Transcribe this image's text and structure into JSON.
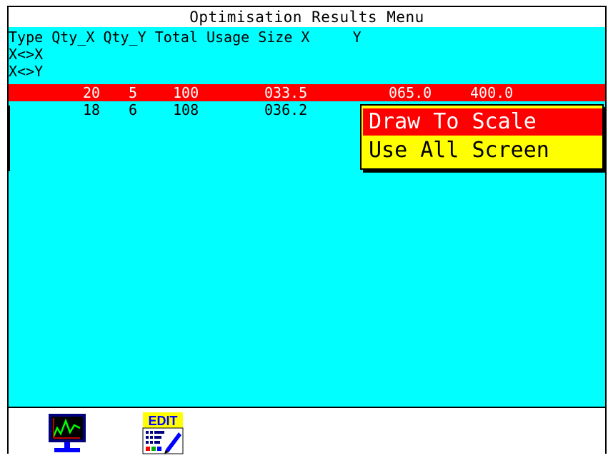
{
  "window": {
    "title": "Optimisation Results Menu"
  },
  "table": {
    "header": "Type Qty_X Qty_Y Total Usage Size X     Y",
    "type_options": [
      "X<>X",
      "X<>Y"
    ],
    "rows": [
      {
        "qty_x": "20",
        "qty_y": "5",
        "total": "100",
        "usage": "033.5",
        "size_x": "065.0",
        "size_y": "400.0",
        "selected": true
      },
      {
        "qty_x": "18",
        "qty_y": "6",
        "total": "108",
        "usage": "036.2",
        "size_x": "",
        "size_y": "",
        "selected": false
      }
    ]
  },
  "popup_menu": {
    "items": [
      {
        "label": "Draw To Scale",
        "selected": true
      },
      {
        "label": "Use All Screen",
        "selected": false
      }
    ]
  },
  "toolbar": {
    "buttons": [
      {
        "icon": "monitor-graph-icon"
      },
      {
        "icon": "edit-icon",
        "label": "EDIT"
      }
    ]
  },
  "colors": {
    "background": "#00ffff",
    "highlight": "#ff0000",
    "popup": "#ffff00"
  }
}
